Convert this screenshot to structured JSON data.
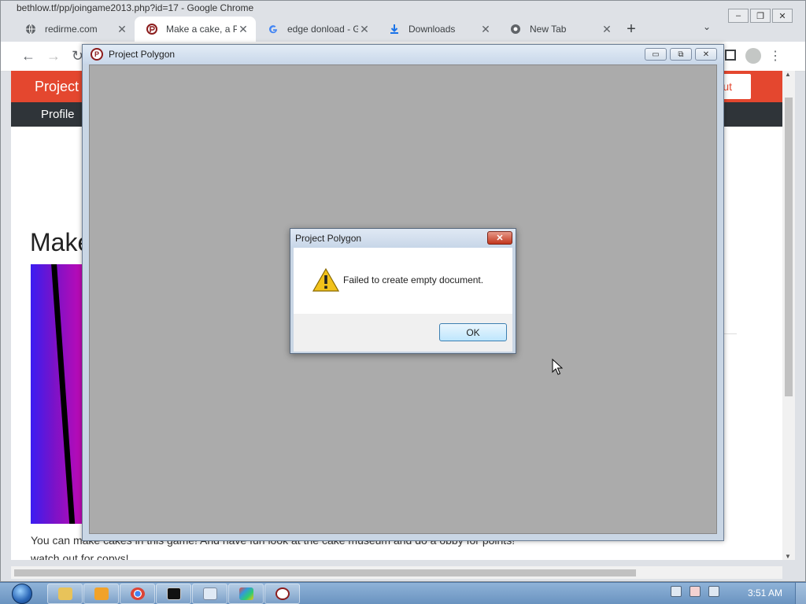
{
  "browser": {
    "window_title": "bethlow.tf/pp/joingame2013.php?id=17 - Google Chrome",
    "tabs": [
      {
        "title": "redirme.com",
        "icon": "globe-icon"
      },
      {
        "title": "Make a cake, a P",
        "icon": "project-polygon-icon"
      },
      {
        "title": "edge donload - G",
        "icon": "google-icon"
      },
      {
        "title": "Downloads",
        "icon": "download-icon"
      },
      {
        "title": "New Tab",
        "icon": "chrome-icon"
      }
    ],
    "new_tab": "+",
    "tab_search": "⌄",
    "close": "✕",
    "nav": {
      "back": "←",
      "forward": "→",
      "reload": "↻",
      "menu": "⋮"
    }
  },
  "site": {
    "brand": "Project",
    "logout": "out",
    "nav_profile": "Profile",
    "game_title": "Make",
    "game_description": "You can make cakes in this game! And have fun look at the cake museum and do a obby for points! watch out for copys!",
    "header_color": "#e4472f",
    "nav_color": "#2f3439"
  },
  "app_window": {
    "title": "Project Polygon",
    "controls": {
      "minimize": "▭",
      "restore": "⧉",
      "close": "✕"
    },
    "client_color": "#ababab"
  },
  "dialog": {
    "title": "Project Polygon",
    "close": "✕",
    "message": "Failed to create empty document.",
    "ok_label": "OK",
    "icon": "warning-icon"
  },
  "taskbar": {
    "clock": "3:51 AM",
    "items": [
      "explorer-icon",
      "media-player-icon",
      "chrome-icon",
      "cmd-icon",
      "notepad-icon",
      "paint-icon",
      "project-polygon-icon"
    ]
  }
}
